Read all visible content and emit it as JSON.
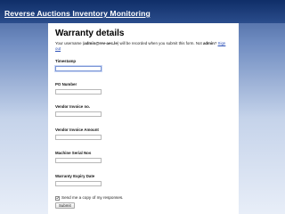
{
  "page": {
    "title": "Reverse Auctions Inventory Monitoring"
  },
  "form": {
    "title": "Warranty details",
    "notice_prefix": "Your username (",
    "notice_username": "admin@rev-aec.le",
    "notice_mid": ") will be recorded when you submit this form. Not ",
    "notice_user": "admin",
    "notice_suffix": "? ",
    "notice_link": "Sign out",
    "fields": [
      {
        "label": "Timestamp",
        "value": ""
      },
      {
        "label": "PO Number",
        "value": ""
      },
      {
        "label": "Vendor Invoice no.",
        "value": ""
      },
      {
        "label": "Vendor Invoice Amount",
        "value": ""
      },
      {
        "label": "Machine Serial Nos",
        "value": ""
      },
      {
        "label": "Warranty Expiry Date",
        "value": ""
      }
    ],
    "send_copy_label": "Send me a copy of my responses.",
    "send_copy_checked": true,
    "submit_label": "Submit"
  },
  "colors": {
    "header_band": "#0f2e68",
    "background_top": "#3f5d96",
    "background_bottom": "#e8eef8",
    "link": "#2a4fb7"
  }
}
